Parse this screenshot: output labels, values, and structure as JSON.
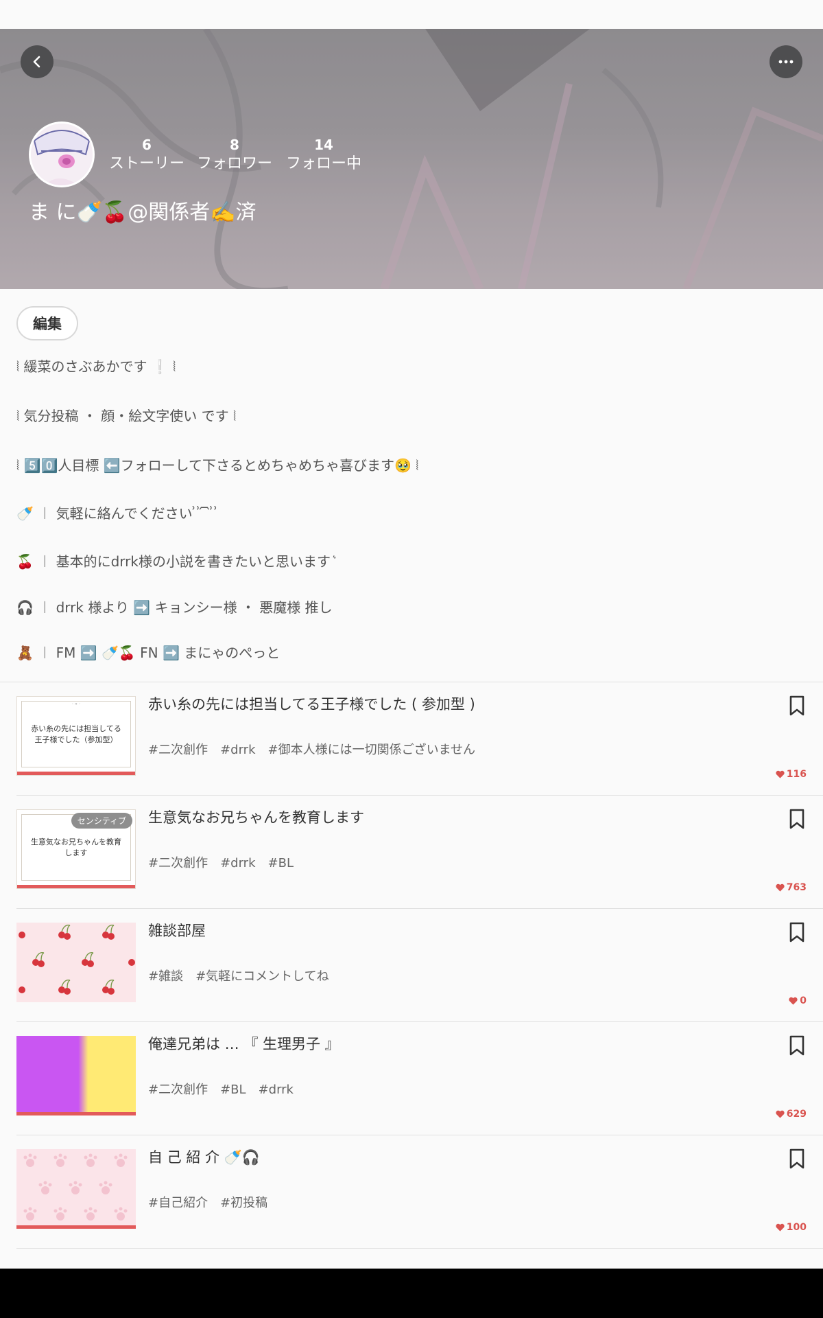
{
  "header": {
    "username": "ま に🍼🍒@関係者✍️済",
    "stats": [
      {
        "value": "6",
        "label": "ストーリー"
      },
      {
        "value": "8",
        "label": "フォロワー"
      },
      {
        "value": "14",
        "label": "フォロー中"
      }
    ]
  },
  "edit_label": "編集",
  "bio": [
    "⦚ 緩菜のさぶあかです ❕ ⦚",
    "⦚ 気分投稿 ・ 顔・絵文字使い です ⦚",
    "⦚ 5️⃣0️⃣人目標 ⬅️フォローして下さるとめちゃめちゃ喜びます🥹 ⦚",
    "🍼 ︱ 気軽に絡んでください ͗ ͗ ᷇ ᷆ ͗ ͗",
    "🍒 ︱ 基本的にdrrk様の小説を書きたいと思います ͛",
    "🎧 ︱ drrk 様より ➡️ キョンシー様 ・ 悪魔様 推し",
    "🧸 ︱ FM ➡️ 🍼🍒 FN ➡️ まにゃのぺっと"
  ],
  "stories": [
    {
      "title": "赤い糸の先には担当してる王子様でした ( 参加型 )",
      "tags": [
        "#二次創作",
        "#drrk",
        "#御本人様には一切関係ございません"
      ],
      "likes": "116",
      "thumb_text": "赤い糸の先には担当してる王子様でした（参加型）",
      "thumb_top": "◦ ❧ ◦"
    },
    {
      "title": "生意気なお兄ちゃんを教育します",
      "tags": [
        "#二次創作",
        "#drrk",
        "#BL"
      ],
      "likes": "763",
      "thumb_text": "生意気なお兄ちゃんを教育します",
      "badge": "センシティブ"
    },
    {
      "title": "雑談部屋",
      "tags": [
        "#雑談",
        "#気軽にコメントしてね"
      ],
      "likes": "0"
    },
    {
      "title": "俺達兄弟は … 『 生理男子 』",
      "tags": [
        "#二次創作",
        "#BL",
        "#drrk"
      ],
      "likes": "629"
    },
    {
      "title": "自 己 紹 介 🍼🎧",
      "tags": [
        "#自己紹介",
        "#初投稿"
      ],
      "likes": "100"
    }
  ],
  "colors": {
    "accent": "#e25a5a",
    "like": "#d9534f",
    "thumb_purple": "#c956f2",
    "thumb_yellow": "#ffea74"
  }
}
